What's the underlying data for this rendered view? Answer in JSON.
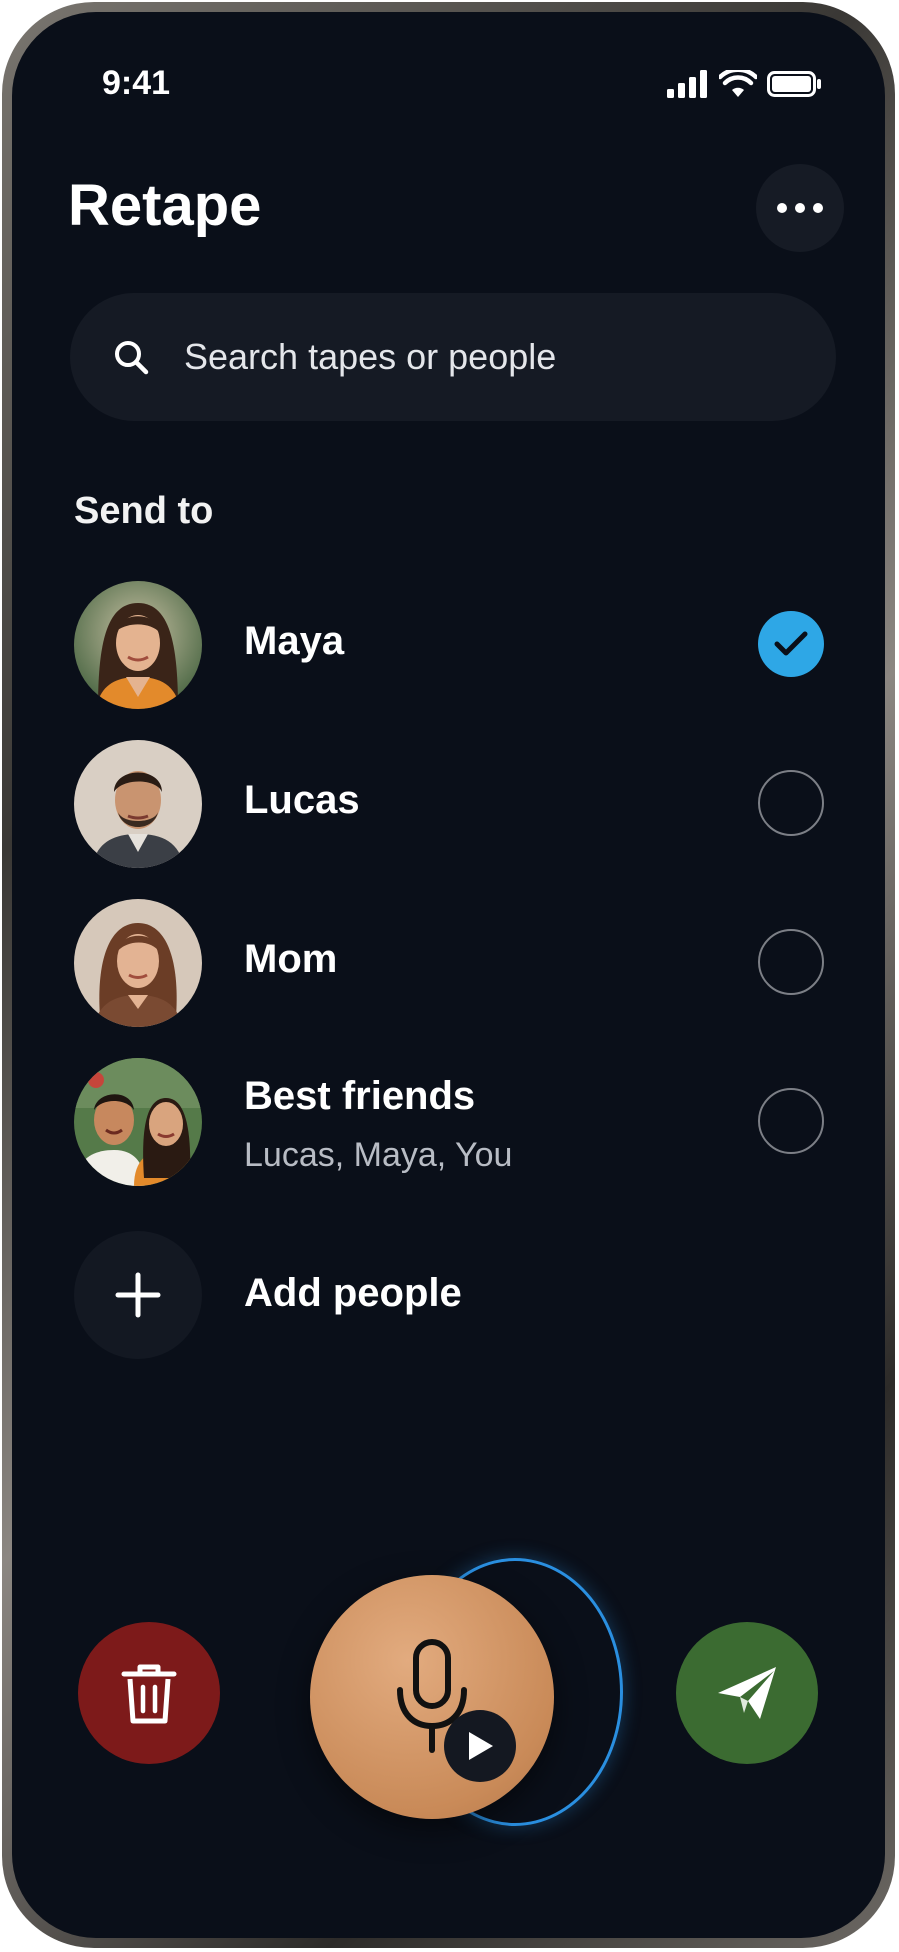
{
  "status_bar": {
    "time": "9:41"
  },
  "header": {
    "title": "Retape",
    "more_icon": "more-horizontal-icon"
  },
  "search": {
    "placeholder": "Search tapes or people",
    "icon": "search-icon"
  },
  "send_to": {
    "label": "Send to",
    "contacts": [
      {
        "name": "Maya",
        "selected": true
      },
      {
        "name": "Lucas",
        "selected": false
      },
      {
        "name": "Mom",
        "selected": false
      },
      {
        "name": "Best friends",
        "members": "Lucas, Maya, You",
        "selected": false
      }
    ],
    "add_label": "Add people"
  },
  "actions": {
    "delete_icon": "trash-icon",
    "record_icon": "microphone-icon",
    "play_icon": "play-icon",
    "send_icon": "send-icon"
  },
  "colors": {
    "background": "#0a0f19",
    "accent_check": "#2ea7e6",
    "delete": "#7d1a1a",
    "send": "#3b6b31",
    "record": "#c98a58",
    "ring": "#2a8fe0"
  }
}
